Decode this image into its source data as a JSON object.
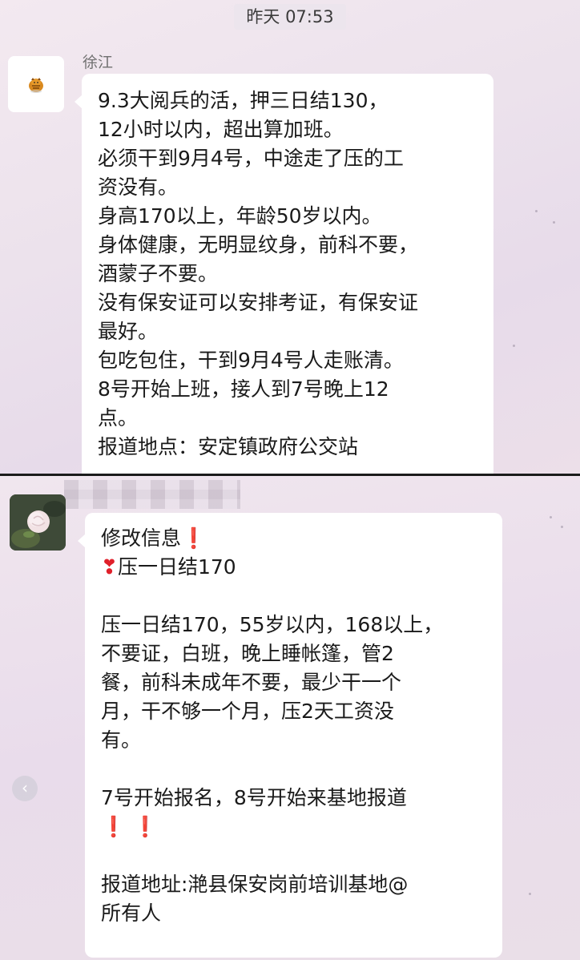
{
  "top_screen": {
    "timestamp": "昨天 07:53",
    "message": {
      "sender": "徐江",
      "lines": [
        "9.3大阅兵的活，押三日结130，",
        "12小时以内，超出算加班。",
        "必须干到9月4号，中途走了压的工",
        "资没有。",
        "身高170以上，年龄50岁以内。",
        "身体健康，无明显纹身，前科不要，",
        "酒蒙子不要。",
        "没有保安证可以安排考证，有保安证",
        "最好。",
        "包吃包住，干到9月4号人走账清。",
        "8号开始上班，接人到7号晚上12",
        "点。",
        "报道地点：安定镇政府公交站"
      ]
    }
  },
  "bottom_screen": {
    "message": {
      "line1": "修改信息",
      "line1_emoji": "❗",
      "line2_emoji": "❣",
      "line2": "压一日结170",
      "para1": [
        "压一日结170，55岁以内，168以上，",
        "不要证，白班，晚上睡帐篷，管2",
        "餐，前科未成年不要，最少干一个",
        "月，干不够一个月，压2天工资没",
        "有。"
      ],
      "para2": "7号开始报名，8号开始来基地报道",
      "para2_emoji": "❗ ❗",
      "para3": [
        "报道地址:滟县保安岗前培训基地@",
        "所有人"
      ]
    },
    "left_arrow": "‹"
  },
  "colors": {
    "background": "#ece2ec",
    "bubble": "#ffffff",
    "text": "#1a1a1a",
    "emoji_red": "#d31b1b",
    "divider": "#1b1b1b"
  }
}
